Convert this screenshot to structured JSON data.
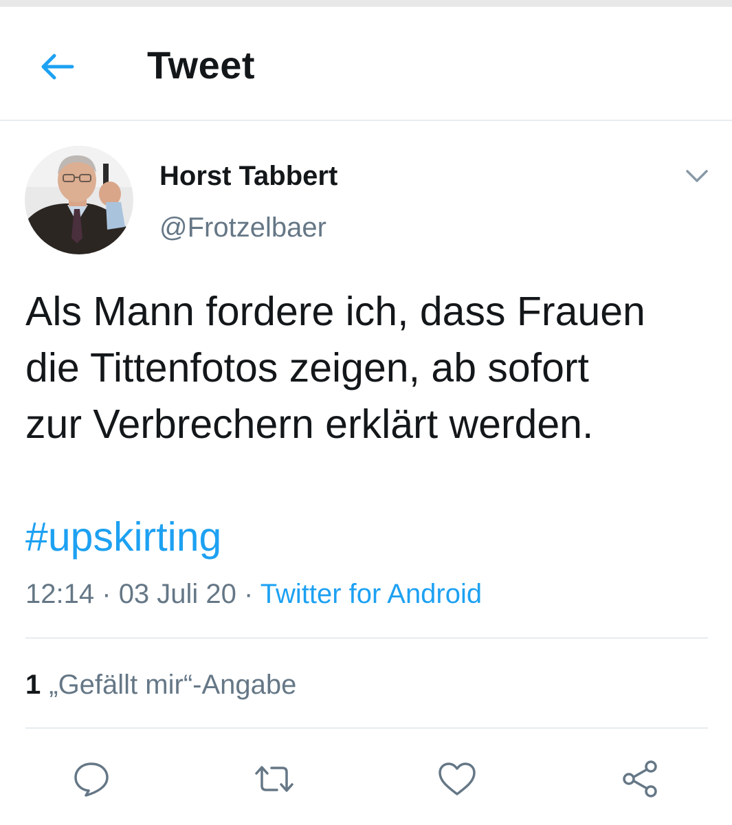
{
  "header": {
    "title": "Tweet",
    "back_icon": "arrow-left-icon",
    "accent_color": "#1da1f2"
  },
  "author": {
    "display_name": "Horst Tabbert",
    "handle": "@Frotzelbaer",
    "avatar": "user-avatar-photo"
  },
  "tweet": {
    "text": "Als Mann fordere ich, dass Frauen\ndie Tittenfotos zeigen, ab sofort\nzur Verbrechern erklärt werden.",
    "hashtag": "#upskirting",
    "time": "12:14",
    "date": "03 Juli 20",
    "separator": "·",
    "source": "Twitter for Android"
  },
  "stats": {
    "like_count": "1",
    "like_label": "„Gefällt mir“-Angabe"
  },
  "actions": {
    "reply_icon": "reply-icon",
    "retweet_icon": "retweet-icon",
    "like_icon": "heart-icon",
    "share_icon": "share-icon"
  },
  "colors": {
    "text_primary": "#14171a",
    "text_secondary": "#657786",
    "link": "#1da1f2",
    "divider": "#e6ecf0"
  }
}
